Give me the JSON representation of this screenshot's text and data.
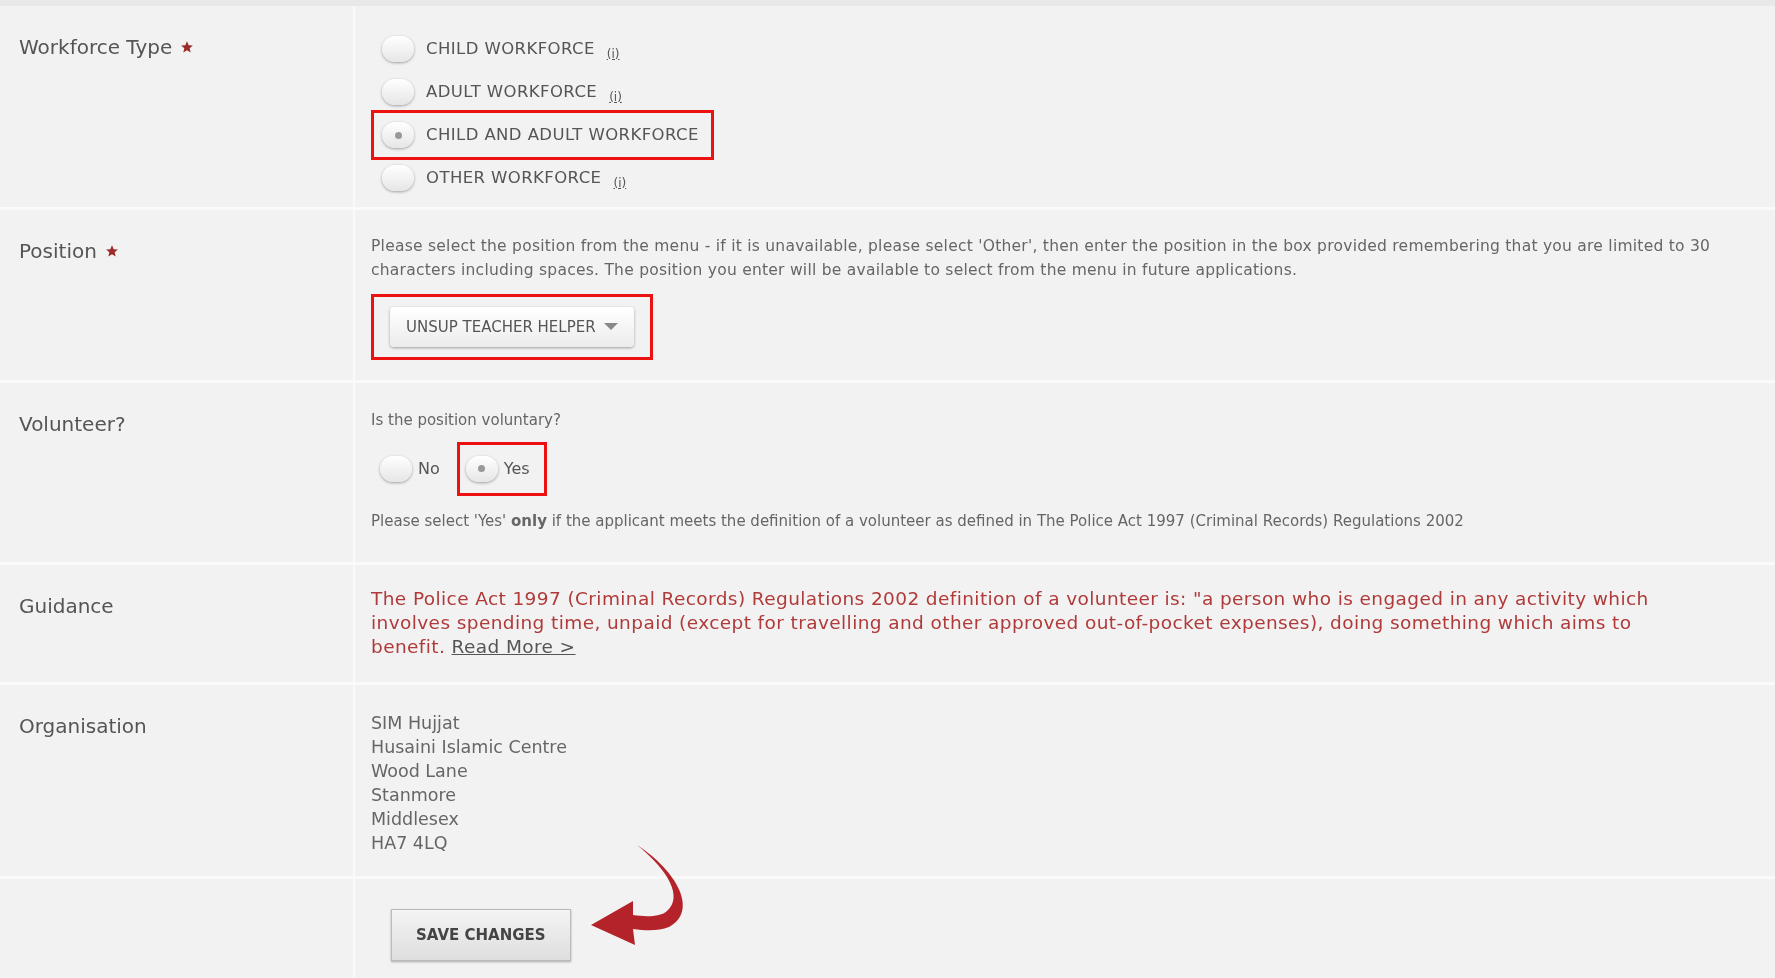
{
  "workforce_type": {
    "label": "Workforce Type",
    "required": true,
    "options": [
      {
        "label": "CHILD WORKFORCE",
        "info": "(i)",
        "selected": false,
        "highlighted": false
      },
      {
        "label": "ADULT WORKFORCE",
        "info": "(i)",
        "selected": false,
        "highlighted": false
      },
      {
        "label": "CHILD AND ADULT WORKFORCE",
        "selected": true,
        "highlighted": true
      },
      {
        "label": "OTHER WORKFORCE",
        "info": "(i)",
        "selected": false,
        "highlighted": false
      }
    ]
  },
  "position": {
    "label": "Position",
    "required": true,
    "help": "Please select the position from the menu - if it is unavailable, please select 'Other', then enter the position in the box provided remembering that you are limited to 30 characters including spaces. The position you enter will be available to select from the menu in future applications.",
    "value": "UNSUP TEACHER HELPER",
    "highlighted": true
  },
  "volunteer": {
    "label": "Volunteer?",
    "question": "Is the position voluntary?",
    "options": [
      {
        "label": "No",
        "selected": false,
        "highlighted": false
      },
      {
        "label": "Yes",
        "selected": true,
        "highlighted": true
      }
    ],
    "note": "Please select 'Yes' **only** if the applicant meets the definition of a volunteer as defined in The Police Act 1997 (Criminal Records) Regulations 2002"
  },
  "guidance": {
    "label": "Guidance",
    "text": "The Police Act 1997 (Criminal Records) Regulations 2002 definition of a volunteer is: \"a person who is engaged in any activity which involves spending time, unpaid (except for travelling and other approved out-of-pocket expenses), doing something which aims to benefit.",
    "link": "Read More >"
  },
  "organisation": {
    "label": "Organisation",
    "lines": [
      "SIM Hujjat",
      "Husaini Islamic Centre",
      "Wood Lane",
      "Stanmore",
      "Middlesex",
      "HA7 4LQ"
    ]
  },
  "save_button": "SAVE CHANGES"
}
